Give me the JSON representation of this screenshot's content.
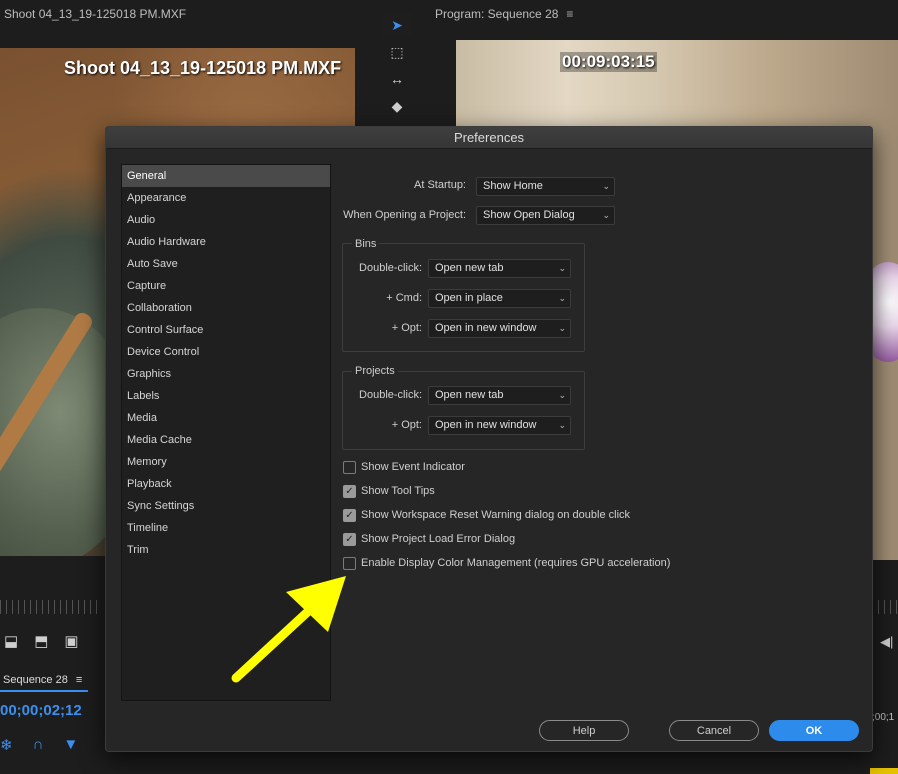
{
  "source_panel": {
    "header": "Shoot 04_13_19-125018 PM.MXF",
    "overlay_title": "Shoot 04_13_19-125018 PM.MXF"
  },
  "program_panel": {
    "header": "Program: Sequence 28",
    "timecode_overlay": "00:09:03:15"
  },
  "timeline": {
    "sequence_tab": "Sequence 28",
    "timecode": "00;00;02;12",
    "timecode_prefix_label": "00;00;02;12"
  },
  "dialog": {
    "title": "Preferences",
    "categories": [
      "General",
      "Appearance",
      "Audio",
      "Audio Hardware",
      "Auto Save",
      "Capture",
      "Collaboration",
      "Control Surface",
      "Device Control",
      "Graphics",
      "Labels",
      "Media",
      "Media Cache",
      "Memory",
      "Playback",
      "Sync Settings",
      "Timeline",
      "Trim"
    ],
    "selected_category": "General",
    "startup": {
      "label": "At Startup:",
      "value": "Show Home"
    },
    "opening_project": {
      "label": "When Opening a Project:",
      "value": "Show Open Dialog"
    },
    "bins": {
      "title": "Bins",
      "double_click": {
        "label": "Double-click:",
        "value": "Open new tab"
      },
      "cmd": {
        "label": "+ Cmd:",
        "value": "Open in place"
      },
      "opt": {
        "label": "+ Opt:",
        "value": "Open in new window"
      }
    },
    "projects": {
      "title": "Projects",
      "double_click": {
        "label": "Double-click:",
        "value": "Open new tab"
      },
      "opt": {
        "label": "+ Opt:",
        "value": "Open in new window"
      }
    },
    "checkboxes": [
      {
        "label": "Show Event Indicator",
        "checked": false
      },
      {
        "label": "Show Tool Tips",
        "checked": true
      },
      {
        "label": "Show Workspace Reset Warning dialog on double click",
        "checked": true
      },
      {
        "label": "Show Project Load Error Dialog",
        "checked": true
      },
      {
        "label": "Enable Display Color Management (requires GPU acceleration)",
        "checked": false
      }
    ],
    "buttons": {
      "help": "Help",
      "cancel": "Cancel",
      "ok": "OK"
    }
  },
  "colors": {
    "accent": "#2d8ceb",
    "annotation_arrow": "#ffff00",
    "timecode_blue": "#3a8fef"
  },
  "icons": {
    "menu": "≡",
    "chevron": "⌄",
    "check": "✓"
  }
}
